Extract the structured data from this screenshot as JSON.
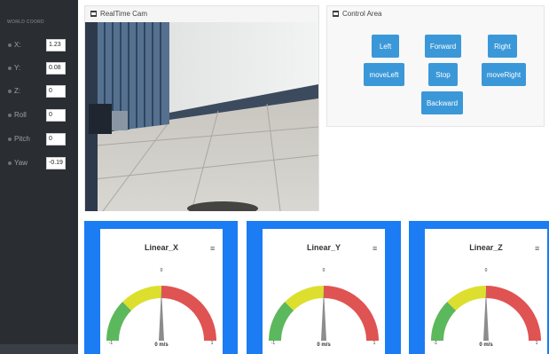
{
  "sidebar": {
    "title": "WORLD COORD",
    "fields": [
      {
        "label": "X:",
        "value": "1.23"
      },
      {
        "label": "Y:",
        "value": "0.08"
      },
      {
        "label": "Z:",
        "value": "0"
      },
      {
        "label": "Roll",
        "value": "0"
      },
      {
        "label": "Pitch",
        "value": "0"
      },
      {
        "label": "Yaw",
        "value": "-0.19"
      }
    ]
  },
  "camera": {
    "title": "RealTime Cam"
  },
  "control": {
    "title": "Control Area",
    "buttons": {
      "left": "Left",
      "forward": "Forward",
      "right": "Right",
      "move_left": "moveLeft",
      "stop": "Stop",
      "move_right": "moveRight",
      "backward": "Backward"
    }
  },
  "gauges": [
    {
      "title": "Linear_X",
      "value": "0 m/s",
      "min": "-1",
      "max": "1",
      "mid": "0",
      "needle": 0
    },
    {
      "title": "Linear_Y",
      "value": "0 m/s",
      "min": "-1",
      "max": "1",
      "mid": "0",
      "needle": 0
    },
    {
      "title": "Linear_Z",
      "value": "0 m/s",
      "min": "-1",
      "max": "1",
      "mid": "0",
      "needle": 0
    }
  ],
  "colors": {
    "sidebar_bg": "#2a2e33",
    "button": "#3b98d8",
    "gauge_frame": "#1b7cf4",
    "band_green": "#5cb85c",
    "band_yellow": "#dddf2f",
    "band_red": "#df5353"
  }
}
